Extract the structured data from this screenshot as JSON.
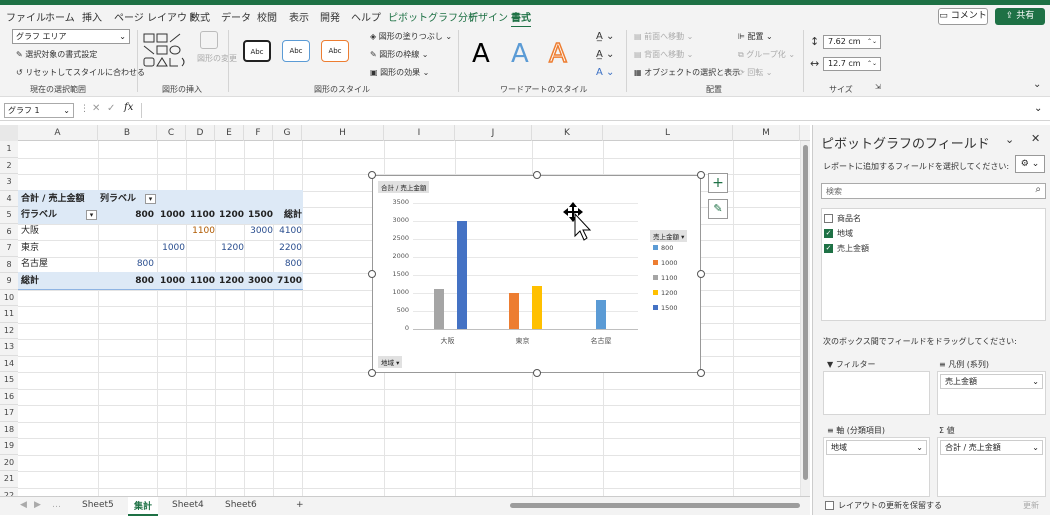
{
  "menu": {
    "items": [
      "ファイル",
      "ホーム",
      "挿入",
      "ページ レイアウト",
      "数式",
      "データ",
      "校閲",
      "表示",
      "開発",
      "ヘルプ",
      "ピボットグラフ分析",
      "デザイン",
      "書式"
    ],
    "comment": "コメント",
    "share": "共有"
  },
  "ribbon": {
    "selection_dropdown": "グラフ エリア",
    "format_selection": "選択対象の書式設定",
    "reset_style": "リセットしてスタイルに合わせる",
    "current_selection_label": "現在の選択範囲",
    "shape_change": "図形の変更",
    "insert_shapes_label": "図形の挿入",
    "style_sample": "Abc",
    "shape_fill": "図形の塗りつぶし",
    "shape_outline": "図形の枠線",
    "shape_effects": "図形の効果",
    "shape_styles_label": "図形のスタイル",
    "wordart_letter": "A",
    "wordart_label": "ワードアートのスタイル",
    "bring_forward": "前面へ移動",
    "send_backward": "背面へ移動",
    "selection_pane": "オブジェクトの選択と表示",
    "align": "配置",
    "group": "グループ化",
    "rotate": "回転",
    "arrange_label": "配置",
    "height": "7.62 cm",
    "width": "12.7 cm",
    "size_label": "サイズ"
  },
  "formula_bar": {
    "name_box": "グラフ 1",
    "fx": "fx"
  },
  "grid": {
    "columns": [
      "A",
      "B",
      "C",
      "D",
      "E",
      "F",
      "G",
      "H",
      "I",
      "J",
      "K",
      "L",
      "M"
    ],
    "rows": [
      "1",
      "2",
      "3",
      "4",
      "5",
      "6",
      "7",
      "8",
      "9",
      "10",
      "11",
      "12",
      "13",
      "14",
      "15",
      "16",
      "17",
      "18",
      "19",
      "20",
      "21",
      "22"
    ],
    "pivot": {
      "title": "合計 / 売上金額",
      "col_label": "列ラベル",
      "row_label": "行ラベル",
      "col_headers": [
        "800",
        "1000",
        "1100",
        "1200",
        "1500",
        "総計"
      ],
      "rows": [
        {
          "name": "大阪",
          "v1100": "1100",
          "v1500": "3000",
          "total": "4100"
        },
        {
          "name": "東京",
          "v1000": "1000",
          "v1200": "1200",
          "total": "2200"
        },
        {
          "name": "名古屋",
          "v800": "800",
          "total": "800"
        }
      ],
      "grand": {
        "label": "総計",
        "values": [
          "800",
          "1000",
          "1100",
          "1200",
          "3000",
          "7100"
        ]
      }
    }
  },
  "chart": {
    "value_button": "合計 / 売上金額",
    "axis_button": "地域",
    "legend_button": "売上金額"
  },
  "chart_data": {
    "type": "bar",
    "categories": [
      "大阪",
      "東京",
      "名古屋"
    ],
    "series": [
      {
        "name": "800",
        "color": "#5b9bd5",
        "values": [
          null,
          null,
          800
        ]
      },
      {
        "name": "1000",
        "color": "#ed7d31",
        "values": [
          null,
          1000,
          null
        ]
      },
      {
        "name": "1100",
        "color": "#a5a5a5",
        "values": [
          1100,
          null,
          null
        ]
      },
      {
        "name": "1200",
        "color": "#ffc000",
        "values": [
          null,
          1200,
          null
        ]
      },
      {
        "name": "1500",
        "color": "#4472c4",
        "values": [
          3000,
          null,
          null
        ]
      }
    ],
    "yticks": [
      "0",
      "500",
      "1000",
      "1500",
      "2000",
      "2500",
      "3000",
      "3500"
    ],
    "ylim": [
      0,
      3500
    ],
    "grid": true,
    "legend": "right"
  },
  "pane": {
    "title": "ピボットグラフのフィールド",
    "subtitle": "レポートに追加するフィールドを選択してください:",
    "search": "検索",
    "fields": [
      {
        "label": "商品名",
        "checked": false
      },
      {
        "label": "地域",
        "checked": true
      },
      {
        "label": "売上金額",
        "checked": true
      }
    ],
    "drag_hint": "次のボックス間でフィールドをドラッグしてください:",
    "filter": "フィルター",
    "legend_area": "凡例 (系列)",
    "legend_value": "売上金額",
    "axis_area": "軸 (分類項目)",
    "axis_value": "地域",
    "values_area": "値",
    "values_value": "合計 / 売上金額",
    "defer": "レイアウトの更新を保留する",
    "update": "更新"
  },
  "sheets": [
    "Sheet5",
    "集計",
    "Sheet4",
    "Sheet6"
  ]
}
